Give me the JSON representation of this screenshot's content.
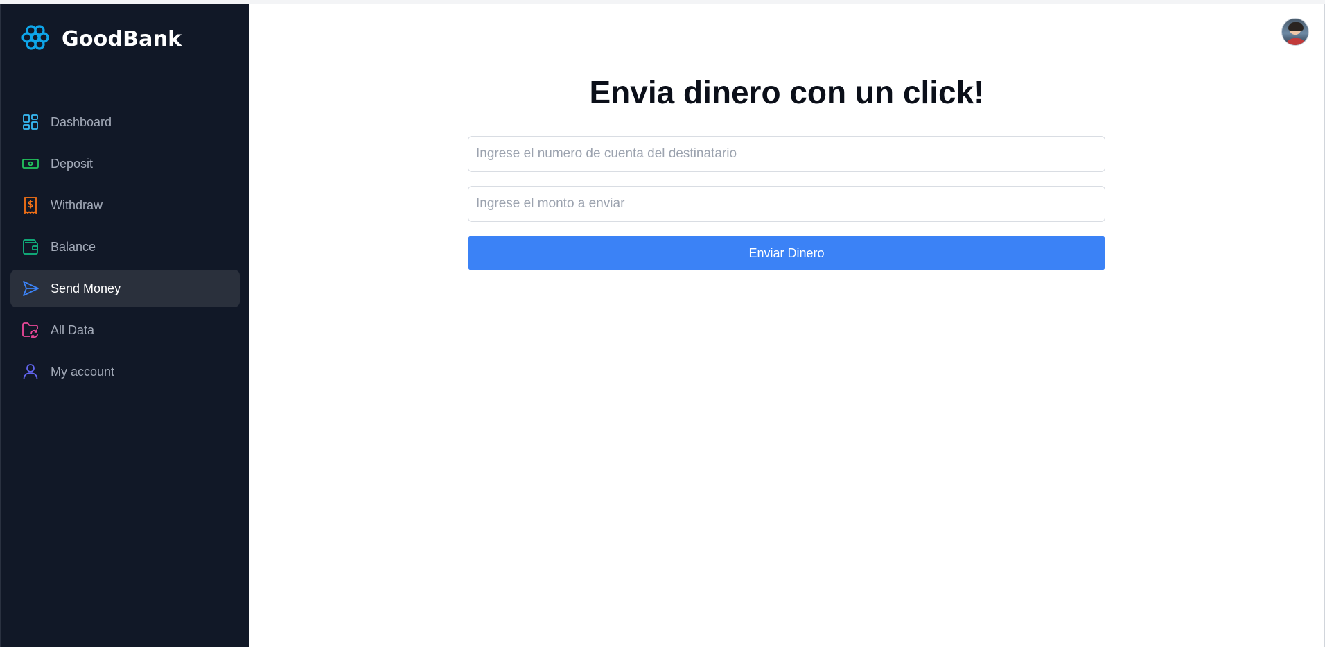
{
  "app": {
    "brand": "GoodBank"
  },
  "sidebar": {
    "items": [
      {
        "label": "Dashboard",
        "icon": "dashboard-icon",
        "color": "#38bdf8",
        "active": false
      },
      {
        "label": "Deposit",
        "icon": "cash-icon",
        "color": "#22c55e",
        "active": false
      },
      {
        "label": "Withdraw",
        "icon": "dollar-receipt-icon",
        "color": "#f97316",
        "active": false
      },
      {
        "label": "Balance",
        "icon": "wallet-icon",
        "color": "#10b981",
        "active": false
      },
      {
        "label": "Send Money",
        "icon": "send-icon",
        "color": "#3b82f6",
        "active": true
      },
      {
        "label": "All Data",
        "icon": "folder-sync-icon",
        "color": "#ec4899",
        "active": false
      },
      {
        "label": "My account",
        "icon": "user-icon",
        "color": "#6366f1",
        "active": false
      }
    ]
  },
  "main": {
    "title": "Envia dinero con un click!",
    "account_field": {
      "placeholder": "Ingrese el numero de cuenta del destinatario",
      "value": ""
    },
    "amount_field": {
      "placeholder": "Ingrese el monto a enviar",
      "value": ""
    },
    "submit_label": "Enviar Dinero"
  },
  "colors": {
    "sidebar_bg": "#111827",
    "accent": "#3b82f6",
    "brand_icon": "#0ea5e9"
  }
}
